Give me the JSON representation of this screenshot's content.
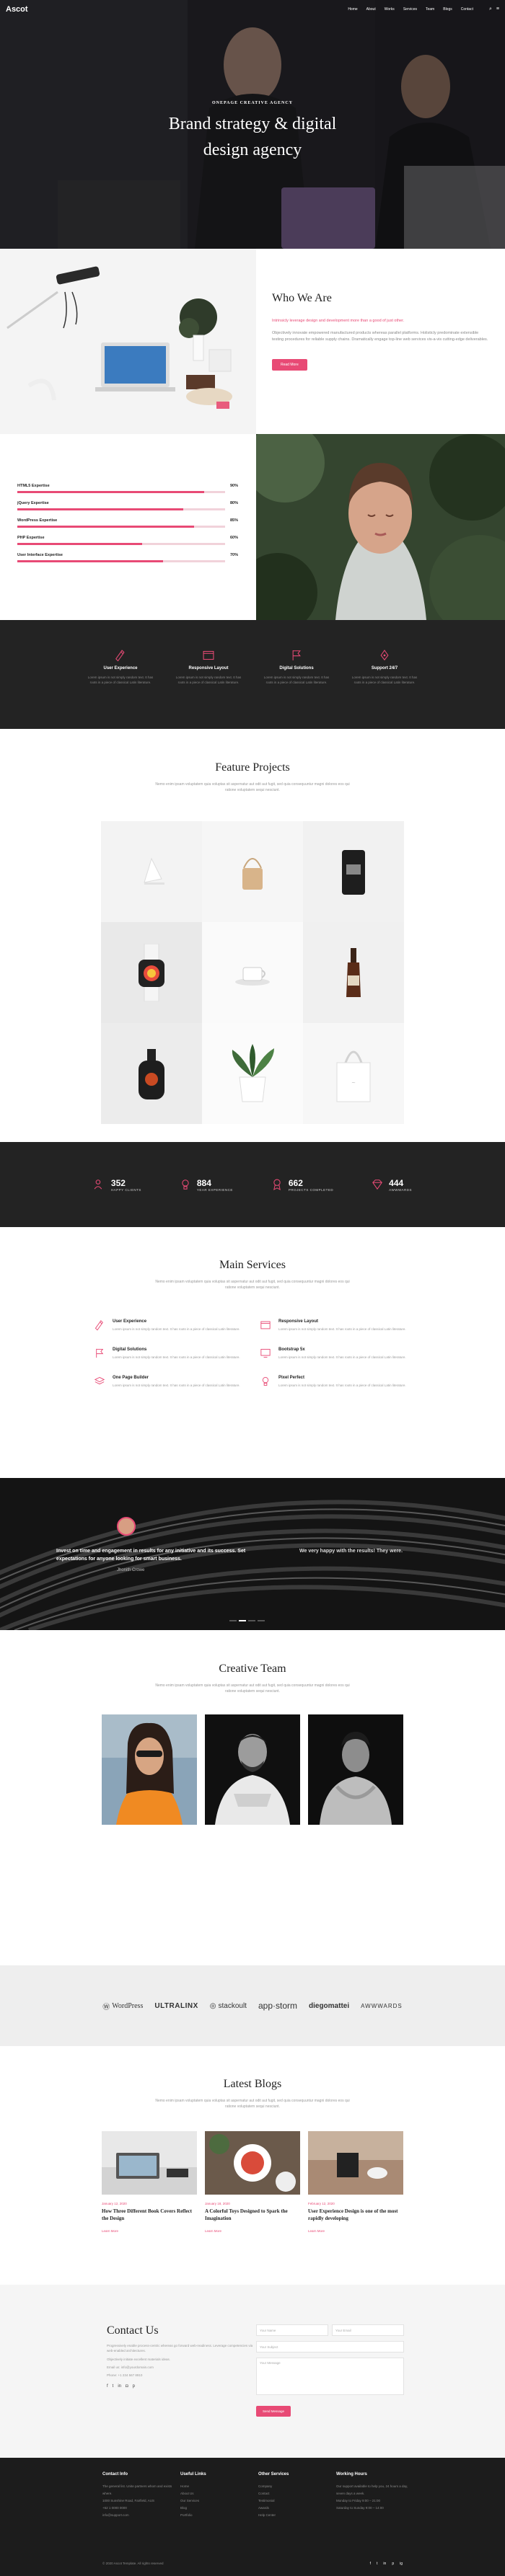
{
  "nav": {
    "logo": "Ascot",
    "menu": [
      "Home",
      "About",
      "Works",
      "Services",
      "Team",
      "Blogs",
      "Contact"
    ]
  },
  "hero": {
    "kicker": "ONEPAGE CREATIVE AGENCY",
    "title_line1": "Brand strategy & digital",
    "title_line2": "design agency"
  },
  "who": {
    "title": "Who We Are",
    "lead": "Intrinsicly leverage design and development more than a good of just other.",
    "body": "Objectively innovate empowered manufactured products whereas parallel platforms. Holisticly predominate extensible testing procedures for reliable supply chains. Dramatically engage top-line web services vis-a-vis cutting-edge deliverables.",
    "button": "Read More"
  },
  "skills": [
    {
      "label": "HTML5 Expertise",
      "value": 90,
      "pct": "90%"
    },
    {
      "label": "jQuery Expertise",
      "value": 80,
      "pct": "80%"
    },
    {
      "label": "WordPress Expertise",
      "value": 85,
      "pct": "85%"
    },
    {
      "label": "PHP Expertise",
      "value": 60,
      "pct": "60%"
    },
    {
      "label": "User Interface Expertise",
      "value": 70,
      "pct": "70%"
    }
  ],
  "features": [
    {
      "icon": "pen-icon",
      "title": "User Experience",
      "desc": "Lorem ipsum is not simply random text. It has roots in a piece of classical Latin literature."
    },
    {
      "icon": "browser-icon",
      "title": "Responsive Layout",
      "desc": "Lorem ipsum is not simply random text. It has roots in a piece of classical Latin literature."
    },
    {
      "icon": "flag-icon",
      "title": "Digital Solutions",
      "desc": "Lorem ipsum is not simply random text. It has roots in a piece of classical Latin literature."
    },
    {
      "icon": "pen-tool-icon",
      "title": "Support 24/7",
      "desc": "Lorem ipsum is not simply random text. It has roots in a piece of classical Latin literature."
    }
  ],
  "projects": {
    "title": "Feature Projects",
    "subtitle": "Nemo enim ipsam voluptatem quia voluptas sit aspernatur aut odit aut fugit, sed quia consequuntur magni dolores eos qui ratione voluptatem sequi nesciunt."
  },
  "counters": [
    {
      "icon": "users-icon",
      "num": "352",
      "label": "HAPPY CLIENTS"
    },
    {
      "icon": "bulb-icon",
      "num": "884",
      "label": "YEAR EXPERIENCE"
    },
    {
      "icon": "award-icon",
      "num": "662",
      "label": "PROJECTS COMPLETED"
    },
    {
      "icon": "diamond-icon",
      "num": "444",
      "label": "AWWWARDS"
    }
  ],
  "services": {
    "title": "Main Services",
    "subtitle": "Nemo enim ipsam voluptatem quia voluptas sit aspernatur aut odit aut fugit, sed quia consequuntur magni dolores eos qui ratione voluptatem sequi nesciunt.",
    "items": [
      {
        "icon": "pen-icon",
        "title": "User Experience",
        "desc": "Lorem ipsum is not simply random text. It has roots in a piece of classical Latin literature."
      },
      {
        "icon": "browser-icon",
        "title": "Responsive Layout",
        "desc": "Lorem ipsum is not simply random text. It has roots in a piece of classical Latin literature."
      },
      {
        "icon": "flag-icon",
        "title": "Digital Solutions",
        "desc": "Lorem ipsum is not simply random text. It has roots in a piece of classical Latin literature."
      },
      {
        "icon": "monitor-icon",
        "title": "Bootstrap 5x",
        "desc": "Lorem ipsum is not simply random text. It has roots in a piece of classical Latin literature."
      },
      {
        "icon": "layers-icon",
        "title": "One Page Builder",
        "desc": "Lorem ipsum is not simply random text. It has roots in a piece of classical Latin literature."
      },
      {
        "icon": "bulb-icon",
        "title": "Pixel Perfect",
        "desc": "Lorem ipsum is not simply random text. It has roots in a piece of classical Latin literature."
      }
    ]
  },
  "testimonial": {
    "quote_left": "Invest on time and engagement in results for any initiative and its success. Set expectations for anyone looking for smart business.",
    "quote_right": "We very happy with the results! They were.",
    "name": "Jhonith Crowe"
  },
  "team": {
    "title": "Creative Team",
    "subtitle": "Nemo enim ipsam voluptatem quia voluptas sit aspernatur aut odit aut fugit, sed quia consequuntur magni dolores eos qui ratione voluptatem sequi nesciunt."
  },
  "brands": [
    "WordPress",
    "ULTRALINX",
    "stackoult",
    "app·storm",
    "diegomattei",
    "AWWWARDS"
  ],
  "blogs": {
    "title": "Latest Blogs",
    "subtitle": "Nemo enim ipsam voluptatem quia voluptas sit aspernatur aut odit aut fugit, sed quia consequuntur magni dolores eos qui ratione voluptatem sequi nesciunt.",
    "posts": [
      {
        "date": "January 12, 2020",
        "title": "How Three Different Book Covers Reflect the Design",
        "more": "Learn More"
      },
      {
        "date": "January 18, 2020",
        "title": "A Colorful Toys Designed to Spark the Imagination",
        "more": "Learn More"
      },
      {
        "date": "February 12, 2020",
        "title": "User Experience Design is one of the most rapidly developing",
        "more": "Learn More"
      }
    ]
  },
  "contact": {
    "title": "Contact Us",
    "p1": "Progressively enable process-centric whereas go forward web-readiness. Leverage competencies via web-enabled architectures.",
    "p2": "Objectively initiate excellent materials ideas.",
    "p3": "Email us: info@yourdomain.com",
    "p4": "Phone: +1 234 567 8910",
    "fields": {
      "name": "Your Name",
      "email": "Your Email",
      "subject": "Your Subject",
      "message": "Your Message"
    },
    "button": "Send Message"
  },
  "footer": {
    "cols": [
      {
        "title": "Contact Info",
        "items": [
          "The general list. Unite partners whom and exists where.",
          "1000 Sunshine Road, Fairfield, AUS",
          "+62 1 0000 0000",
          "info@support.com"
        ]
      },
      {
        "title": "Useful Links",
        "items": [
          "Home",
          "About Us",
          "Our Services",
          "Blog",
          "Portfolio"
        ]
      },
      {
        "title": "Other Services",
        "items": [
          "Company",
          "Contact",
          "Testimonial",
          "Awards",
          "Help Center"
        ]
      },
      {
        "title": "Working Hours",
        "items": [
          "Our support available to help you, 24 hours a day, seven days a week.",
          "Monday to Friday  9:00 – 21:00",
          "Saturday to Sunday  9:00 – 14:00"
        ]
      }
    ],
    "copyright": "© 2020 Ascot Template. All rights reserved",
    "social": [
      "f",
      "t",
      "in",
      "p",
      "ig"
    ]
  }
}
